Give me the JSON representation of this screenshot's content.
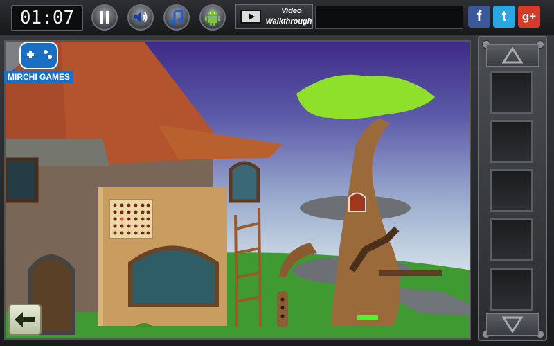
{
  "hud": {
    "timer": "01:07",
    "video": {
      "line1": "Video",
      "line2": "Walkthrough"
    }
  },
  "icons": {
    "pause": "pause-icon",
    "sound": "speaker-icon",
    "music": "music-note-icon",
    "android": "android-icon",
    "video": "film-play-icon",
    "facebook": "facebook-icon",
    "twitter": "twitter-icon",
    "googleplus": "google-plus-icon",
    "back": "left-arrow-icon",
    "up": "up-arrow-icon",
    "down": "down-arrow-icon",
    "logo": "gamepad-icon"
  },
  "social": {
    "facebook": "f",
    "twitter": "t",
    "googleplus": "g+"
  },
  "logo": {
    "text": "MIRCHI GAMES"
  },
  "colors": {
    "facebook": "#3b5998",
    "twitter": "#2aa6e0",
    "googleplus": "#d53a2b",
    "brand": "#1b6fc2",
    "grass": "#3f9a32",
    "roof": "#b4542e",
    "tree_leaves": "#8ee02a",
    "tree_trunk": "#9a6a3a"
  },
  "inventory": {
    "slots": 5
  }
}
